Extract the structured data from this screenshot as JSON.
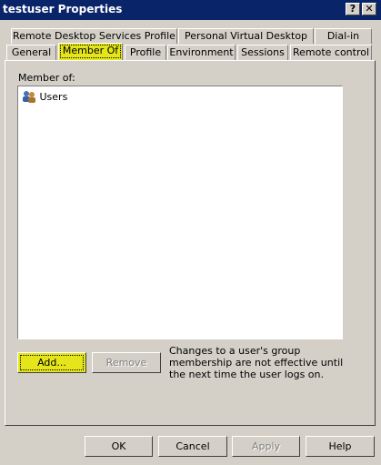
{
  "window": {
    "title": "testuser Properties",
    "help_button": "?",
    "close_button": "✕"
  },
  "tabs_row1": [
    "Remote Desktop Services Profile",
    "Personal Virtual Desktop",
    "Dial-in"
  ],
  "tabs_row2": [
    "General",
    "Member Of",
    "Profile",
    "Environment",
    "Sessions",
    "Remote control"
  ],
  "active_tab": "Member Of",
  "member_of": {
    "label": "Member of:",
    "items": [
      {
        "name": "Users",
        "icon": "group-icon"
      }
    ]
  },
  "actions": {
    "add": "Add...",
    "remove": "Remove"
  },
  "note": "Changes to a user's group membership are not effective until the next time the user logs on.",
  "footer": {
    "ok": "OK",
    "cancel": "Cancel",
    "apply": "Apply",
    "help": "Help"
  },
  "colors": {
    "titlebar": "#0a246a",
    "highlight": "#e5e51b",
    "face": "#d4d0c8"
  }
}
